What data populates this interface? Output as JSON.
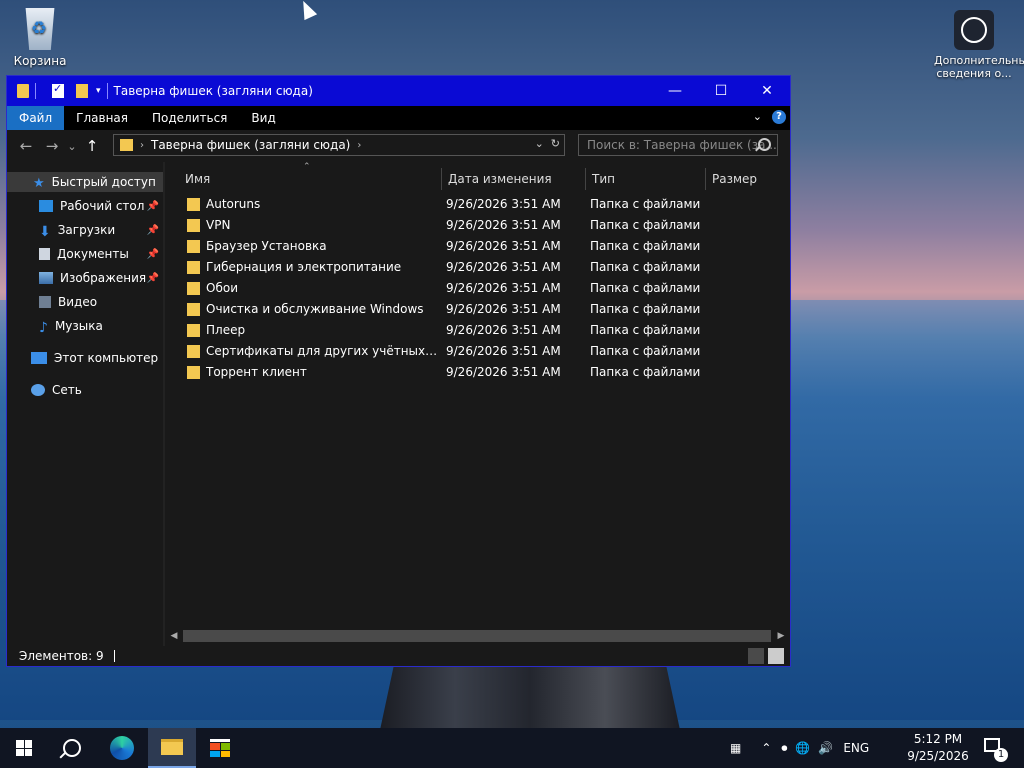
{
  "desktop": {
    "recycle_bin": "Корзина",
    "info_icon": "Дополнительные сведения о..."
  },
  "window": {
    "title": "Таверна фишек (загляни сюда)",
    "controls": {
      "minimize": "—",
      "maximize": "☐",
      "close": "✕"
    }
  },
  "ribbon": {
    "tabs": [
      "Файл",
      "Главная",
      "Поделиться",
      "Вид"
    ],
    "active_tab": "Файл"
  },
  "navigation": {
    "back": "←",
    "forward": "→",
    "recent": "⌄",
    "up": "↑",
    "path": "Таверна фишек (загляни сюда)",
    "search_placeholder": "Поиск в: Таверна фишек (за..."
  },
  "sidebar": {
    "items": [
      {
        "label": "Быстрый доступ",
        "icon": "star-icon",
        "pinned": false,
        "selected": true
      },
      {
        "label": "Рабочий стол",
        "icon": "desktop-icon",
        "pinned": true
      },
      {
        "label": "Загрузки",
        "icon": "download-icon",
        "pinned": true
      },
      {
        "label": "Документы",
        "icon": "document-icon",
        "pinned": true
      },
      {
        "label": "Изображения",
        "icon": "pictures-icon",
        "pinned": true
      },
      {
        "label": "Видео",
        "icon": "video-icon",
        "pinned": false
      },
      {
        "label": "Музыка",
        "icon": "music-icon",
        "pinned": false
      },
      {
        "label": "Этот компьютер",
        "icon": "computer-icon",
        "pinned": false
      },
      {
        "label": "Сеть",
        "icon": "network-icon",
        "pinned": false
      }
    ]
  },
  "file_list": {
    "columns": [
      "Имя",
      "Дата изменения",
      "Тип",
      "Размер"
    ],
    "rows": [
      {
        "name": "Autoruns",
        "date": "9/26/2026 3:51 AM",
        "type": "Папка с файлами"
      },
      {
        "name": "VPN",
        "date": "9/26/2026 3:51 AM",
        "type": "Папка с файлами"
      },
      {
        "name": "Браузер Установка",
        "date": "9/26/2026 3:51 AM",
        "type": "Папка с файлами"
      },
      {
        "name": "Гибернация и электропитание",
        "date": "9/26/2026 3:51 AM",
        "type": "Папка с файлами"
      },
      {
        "name": "Обои",
        "date": "9/26/2026 3:51 AM",
        "type": "Папка с файлами"
      },
      {
        "name": "Очистка и обслуживание Windows",
        "date": "9/26/2026 3:51 AM",
        "type": "Папка с файлами"
      },
      {
        "name": "Плеер",
        "date": "9/26/2026 3:51 AM",
        "type": "Папка с файлами"
      },
      {
        "name": "Сертификаты для других учётных запи...",
        "date": "9/26/2026 3:51 AM",
        "type": "Папка с файлами"
      },
      {
        "name": "Торрент клиент",
        "date": "9/26/2026 3:51 AM",
        "type": "Папка с файлами"
      }
    ]
  },
  "status": {
    "items_count": "Элементов: 9"
  },
  "taskbar": {
    "language": "ENG",
    "time": "5:12 PM",
    "date": "9/25/2026",
    "notifications": "1"
  }
}
